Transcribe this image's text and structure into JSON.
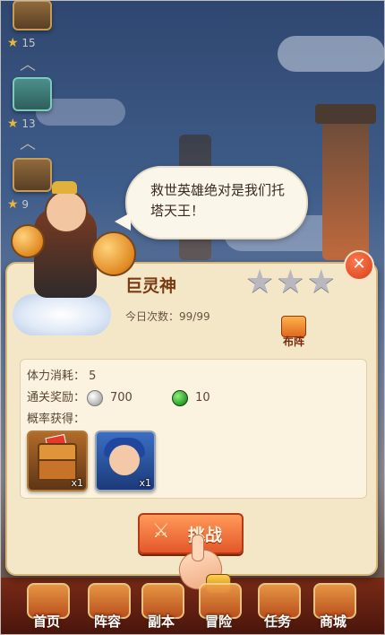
{
  "progress": {
    "stages": [
      {
        "stars_required": "15",
        "chest": "locked"
      },
      {
        "stars_required": "13",
        "chest": "teal"
      },
      {
        "stars_required": "9",
        "chest": "locked"
      }
    ]
  },
  "dialog": {
    "speech": "救世英雄绝对是我们托塔天王！",
    "boss_name": "巨灵神",
    "stars_earned": 0,
    "stars_total": 3,
    "attempts_label": "今日次数：",
    "attempts_value": "99/99",
    "formation_label": "布阵",
    "stamina_label": "体力消耗：",
    "stamina_value": "5",
    "reward_label": "通关奖励：",
    "reward_silver": "700",
    "reward_gem": "10",
    "drop_label": "概率获得：",
    "drop_items": [
      {
        "name": "card-chest",
        "qty": "x1"
      },
      {
        "name": "hero-card",
        "qty": "x1"
      }
    ],
    "challenge_label": "挑战"
  },
  "nav": {
    "items": [
      {
        "label": "首页"
      },
      {
        "label": "阵容"
      },
      {
        "label": "副本"
      },
      {
        "label": "冒险"
      },
      {
        "label": "任务"
      },
      {
        "label": "商城"
      }
    ]
  },
  "colors": {
    "panel": "#f4e7c8",
    "accent": "#e4572a",
    "title": "#7a3a14"
  }
}
